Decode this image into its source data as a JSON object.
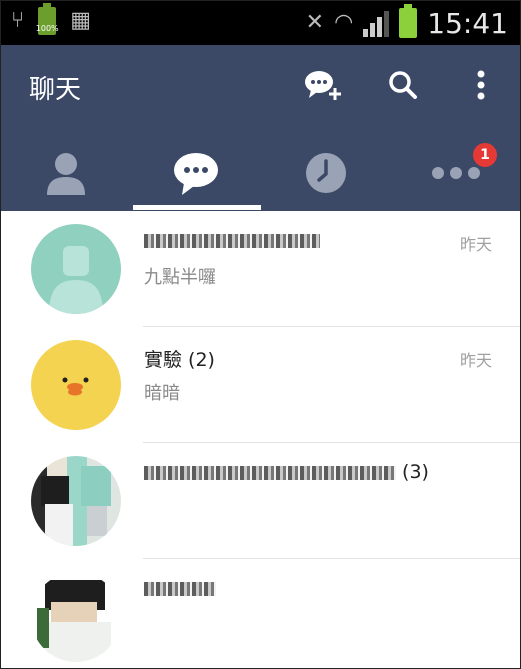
{
  "status_bar": {
    "battery_small_label": "100%",
    "time": "15:41"
  },
  "header": {
    "title": "聊天",
    "actions": [
      "add-chat-icon",
      "search-icon",
      "more-vert-icon"
    ]
  },
  "tabs": {
    "items": [
      "friends-icon",
      "chats-icon",
      "timeline-icon",
      "more-icon"
    ],
    "active_index": 1,
    "more_badge": "1"
  },
  "chats": [
    {
      "name_suffix": "",
      "preview": "九點半囉",
      "date": "昨天",
      "avatar": "default-person"
    },
    {
      "name_suffix": "實驗 (2)",
      "preview": "暗暗",
      "date": "昨天",
      "avatar": "duck"
    },
    {
      "name_suffix": "(3)",
      "preview": "",
      "date": "",
      "avatar": "photo"
    },
    {
      "name_suffix": "",
      "preview": "",
      "date": "",
      "avatar": "photo"
    }
  ],
  "colors": {
    "appbar": "#3b4866",
    "badge": "#e53935",
    "battery": "#8cd13c"
  }
}
